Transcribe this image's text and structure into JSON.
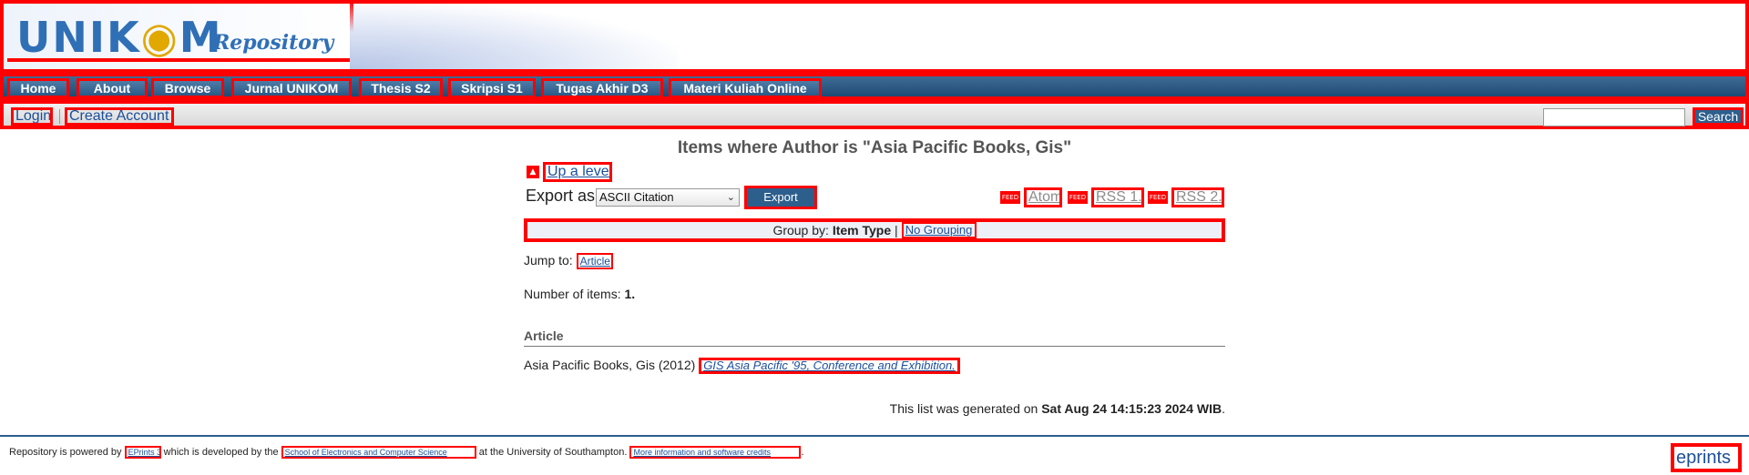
{
  "header": {
    "logo_text": "UNIK",
    "logo_text2": "M",
    "logo_sub": "Repository"
  },
  "nav": {
    "items": [
      {
        "label": "Home"
      },
      {
        "label": "About"
      },
      {
        "label": "Browse"
      },
      {
        "label": "Jurnal UNIKOM"
      },
      {
        "label": "Thesis S2"
      },
      {
        "label": "Skripsi S1"
      },
      {
        "label": "Tugas Akhir D3"
      },
      {
        "label": "Materi Kuliah Online"
      }
    ]
  },
  "userbar": {
    "login": "Login",
    "create_account": "Create Account",
    "search_placeholder": "",
    "search_button": "Search"
  },
  "main": {
    "title": "Items where Author is \"Asia Pacific Books, Gis\"",
    "up_level": "Up a level",
    "export_label": "Export as",
    "export_selected": "ASCII Citation",
    "export_button": "Export",
    "feeds": [
      {
        "icon": "feed-icon",
        "label": "Atom"
      },
      {
        "icon": "feed-icon",
        "label": "RSS 1.0"
      },
      {
        "icon": "feed-icon",
        "label": "RSS 2.0"
      }
    ],
    "group_by_label": "Group by:",
    "group_by_current": "Item Type",
    "group_by_sep": "|",
    "group_by_other": "No Grouping",
    "jump_to_label": "Jump to:",
    "jump_to_link": "Article",
    "number_of_items_label": "Number of items:",
    "number_of_items_value": "1.",
    "section_heading": "Article",
    "item_citation": "Asia Pacific Books, Gis (2012)",
    "item_title": "GIS Asia Pacific '95, Conference and Exhibition.",
    "generated_prefix": "This list was generated on",
    "generated_date": "Sat Aug 24 14:15:23 2024 WIB",
    "generated_suffix": "."
  },
  "footer": {
    "text1": "Repository is powered by",
    "link1": "EPrints 3",
    "text2": "which is developed by the",
    "link2": "School of Electronics and Computer Science",
    "text3": "at the University of Southampton.",
    "link3": "More information and software credits",
    "text4": ".",
    "eprints_logo": "eprints"
  },
  "colors": {
    "nav_bg": "#2d5f8d",
    "link": "#1b4f9a",
    "annotation_box": "#ff0000"
  }
}
